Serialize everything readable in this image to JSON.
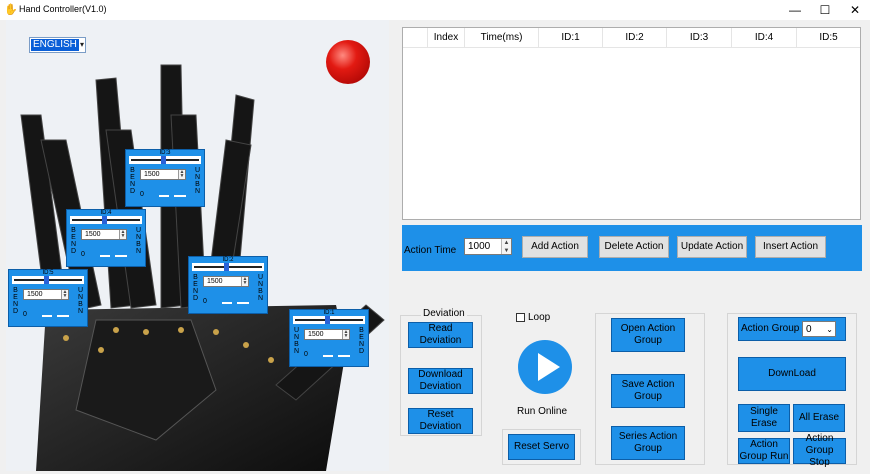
{
  "window": {
    "title": "Hand Controller(V1.0)",
    "app_icon": "hand-icon",
    "controls": [
      "minimize-icon",
      "maximize-icon",
      "close-icon"
    ]
  },
  "language": {
    "selected": "ENGLISH"
  },
  "status_light": {
    "color": "#e21a12"
  },
  "servos": [
    {
      "id": "ID:3",
      "value": "1500",
      "min_label": "0",
      "left_label": "BEND",
      "right_label": "UNBN"
    },
    {
      "id": "ID:4",
      "value": "1500",
      "min_label": "0",
      "left_label": "BEND",
      "right_label": "UNBN"
    },
    {
      "id": "ID:5",
      "value": "1500",
      "min_label": "0",
      "left_label": "BEND",
      "right_label": "UNBN"
    },
    {
      "id": "ID:2",
      "value": "1500",
      "min_label": "0",
      "left_label": "BEND",
      "right_label": "UNBN"
    },
    {
      "id": "ID:1",
      "value": "1500",
      "min_label": "0",
      "left_label": "UNBN",
      "right_label": "BEND"
    }
  ],
  "table": {
    "columns": [
      "Index",
      "Time(ms)",
      "ID:1",
      "ID:2",
      "ID:3",
      "ID:4",
      "ID:5"
    ],
    "rows": []
  },
  "action_bar": {
    "time_label": "Action Time",
    "time_value": "1000",
    "add": "Add Action",
    "delete": "Delete Action",
    "update": "Update Action",
    "insert": "Insert Action"
  },
  "deviation": {
    "caption": "Deviation",
    "read": "Read Deviation",
    "download": "Download Deviation",
    "reset": "Reset Deviation"
  },
  "run": {
    "loop_label": "Loop",
    "run_label": "Run Online",
    "reset_servo": "Reset Servo"
  },
  "action_files": {
    "open": "Open Action Group",
    "save": "Save Action Group",
    "series": "Series Action Group"
  },
  "group_panel": {
    "label": "Action Group",
    "value": "0",
    "download": "DownLoad",
    "single_erase": "Single Erase",
    "all_erase": "All Erase",
    "group_run": "Action Group Run",
    "group_stop": "Action Group Stop"
  },
  "colors": {
    "accent": "#1e90e8",
    "background": "#f0f0f0"
  }
}
